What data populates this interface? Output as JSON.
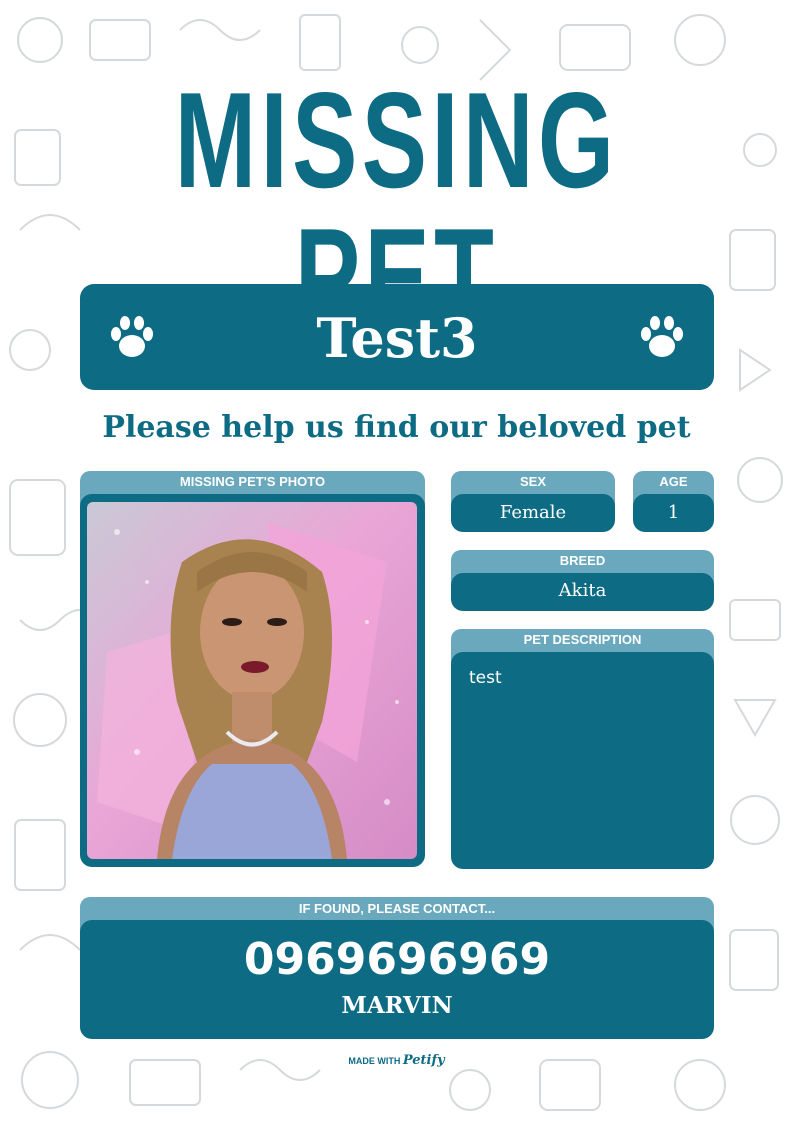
{
  "poster": {
    "title": "MISSING PET",
    "pet_name": "Test3",
    "subtitle": "Please help us find our beloved pet",
    "photo_label": "MISSING PET'S PHOTO",
    "sex_label": "SEX",
    "sex_value": "Female",
    "age_label": "AGE",
    "age_value": "1",
    "breed_label": "BREED",
    "breed_value": "Akita",
    "description_label": "PET DESCRIPTION",
    "description_value": "test",
    "contact_label": "IF FOUND, PLEASE CONTACT...",
    "contact_phone": "0969696969",
    "contact_name": "MARVIN"
  },
  "footer": {
    "made_with": "MADE WITH",
    "brand": "Petify"
  },
  "colors": {
    "primary": "#0e6b84",
    "header_light": "#6aa8bd",
    "background": "#ffffff"
  },
  "icons": [
    "paw-icon"
  ]
}
